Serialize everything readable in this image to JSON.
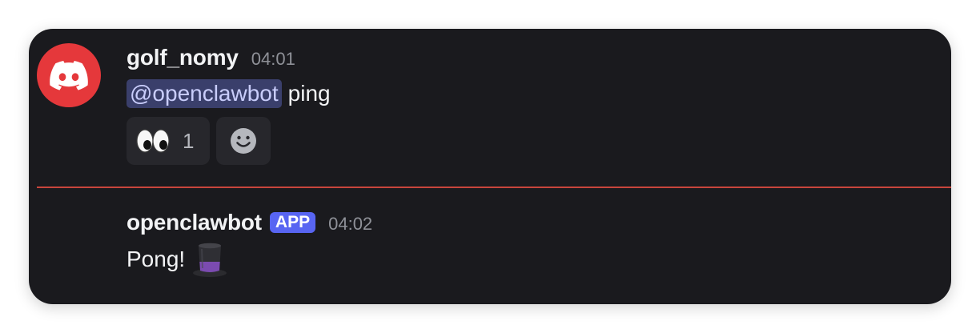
{
  "messages": [
    {
      "author": "golf_nomy",
      "timestamp": "04:01",
      "avatar_icon": "discord-logo-icon",
      "avatar_color": "#e5383b",
      "mention": "@openclawbot",
      "text": "ping",
      "reactions": [
        {
          "icon": "eyes-emoji-icon",
          "count": "1"
        }
      ],
      "add_reaction_icon": "add-reaction-smiley-icon"
    },
    {
      "author": "openclawbot",
      "badge": "APP",
      "timestamp": "04:02",
      "text": "Pong!",
      "emoji_icon": "top-hat-emoji-icon"
    }
  ],
  "colors": {
    "card_background": "#1a1a1e",
    "mention_background": "#3a3f6b",
    "badge_background": "#5865f2",
    "new_messages_divider": "#c8453c"
  }
}
